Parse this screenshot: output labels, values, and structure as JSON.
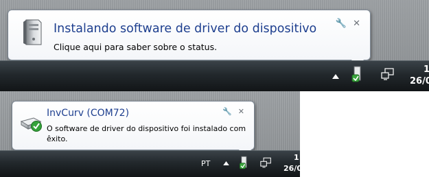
{
  "notification_installing": {
    "title": "Instalando software de driver do dispositivo",
    "message": "Clique aqui para saber sobre o status.",
    "icons": [
      "computer-tower-icon",
      "wrench-icon",
      "close-icon"
    ]
  },
  "taskbar_top": {
    "tray_icons": [
      "show-hidden-icons-arrow",
      "device-driver-install-icon",
      "network-icon"
    ],
    "clock_time_partial": "1",
    "clock_date_partial": "26/0"
  },
  "notification_installed": {
    "title": "InvCurv (COM72)",
    "message": "O software de driver do dispositivo foi instalado com êxito.",
    "icons": [
      "usb-drive-success-icon",
      "wrench-icon",
      "close-icon"
    ]
  },
  "taskbar_bottom": {
    "language": "PT",
    "tray_icons": [
      "show-hidden-icons-arrow",
      "device-driver-success-icon",
      "network-icon"
    ],
    "clock_time_partial": "1",
    "clock_date_partial": "26/0"
  },
  "colors": {
    "balloon_title": "#1e3f8f",
    "balloon_border": "#7f8a96",
    "taskbar": "#22282c",
    "success_green": "#34a33a"
  }
}
